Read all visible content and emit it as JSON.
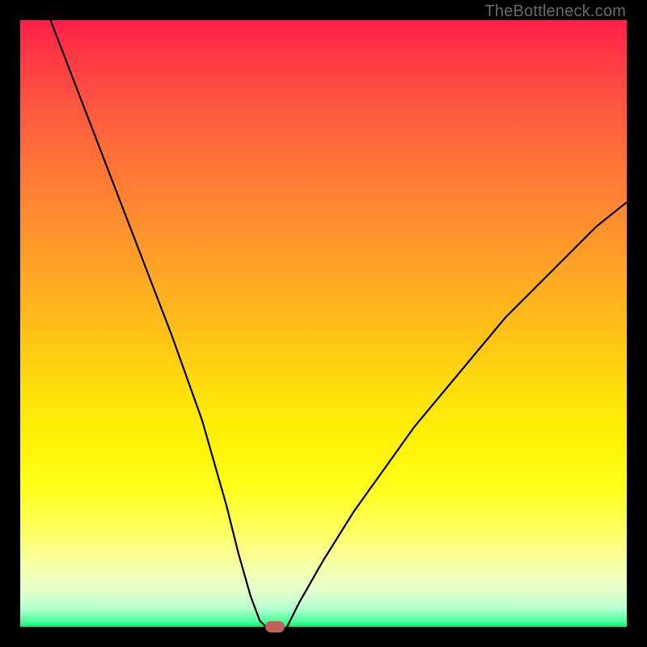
{
  "watermark": "TheBottleneck.com",
  "colors": {
    "frame": "#000000",
    "curve": "#000000",
    "marker": "#c15f59"
  },
  "chart_data": {
    "type": "line",
    "title": "",
    "xlabel": "",
    "ylabel": "",
    "xlim": [
      0,
      100
    ],
    "ylim": [
      0,
      100
    ],
    "grid": false,
    "legend": false,
    "gradient_stops": [
      {
        "pos": 0,
        "color": "#ff1e4a"
      },
      {
        "pos": 14,
        "color": "#ff5640"
      },
      {
        "pos": 40,
        "color": "#ffa127"
      },
      {
        "pos": 62,
        "color": "#ffe20b"
      },
      {
        "pos": 84,
        "color": "#feff60"
      },
      {
        "pos": 97,
        "color": "#b4ffcf"
      },
      {
        "pos": 100,
        "color": "#05f26e"
      }
    ],
    "series": [
      {
        "name": "left-branch",
        "x": [
          5,
          10,
          15,
          20,
          25,
          30,
          34,
          36,
          38,
          39.5,
          40.5
        ],
        "values": [
          100,
          87,
          74,
          61,
          48,
          34,
          20,
          12,
          5,
          1,
          0
        ]
      },
      {
        "name": "right-branch",
        "x": [
          44,
          46,
          50,
          55,
          60,
          65,
          70,
          75,
          80,
          85,
          90,
          95,
          100
        ],
        "values": [
          0,
          4,
          11,
          19,
          26,
          33,
          39,
          45,
          51,
          56,
          61,
          66,
          70
        ]
      }
    ],
    "marker": {
      "x": 42,
      "y": 0,
      "label": ""
    }
  }
}
